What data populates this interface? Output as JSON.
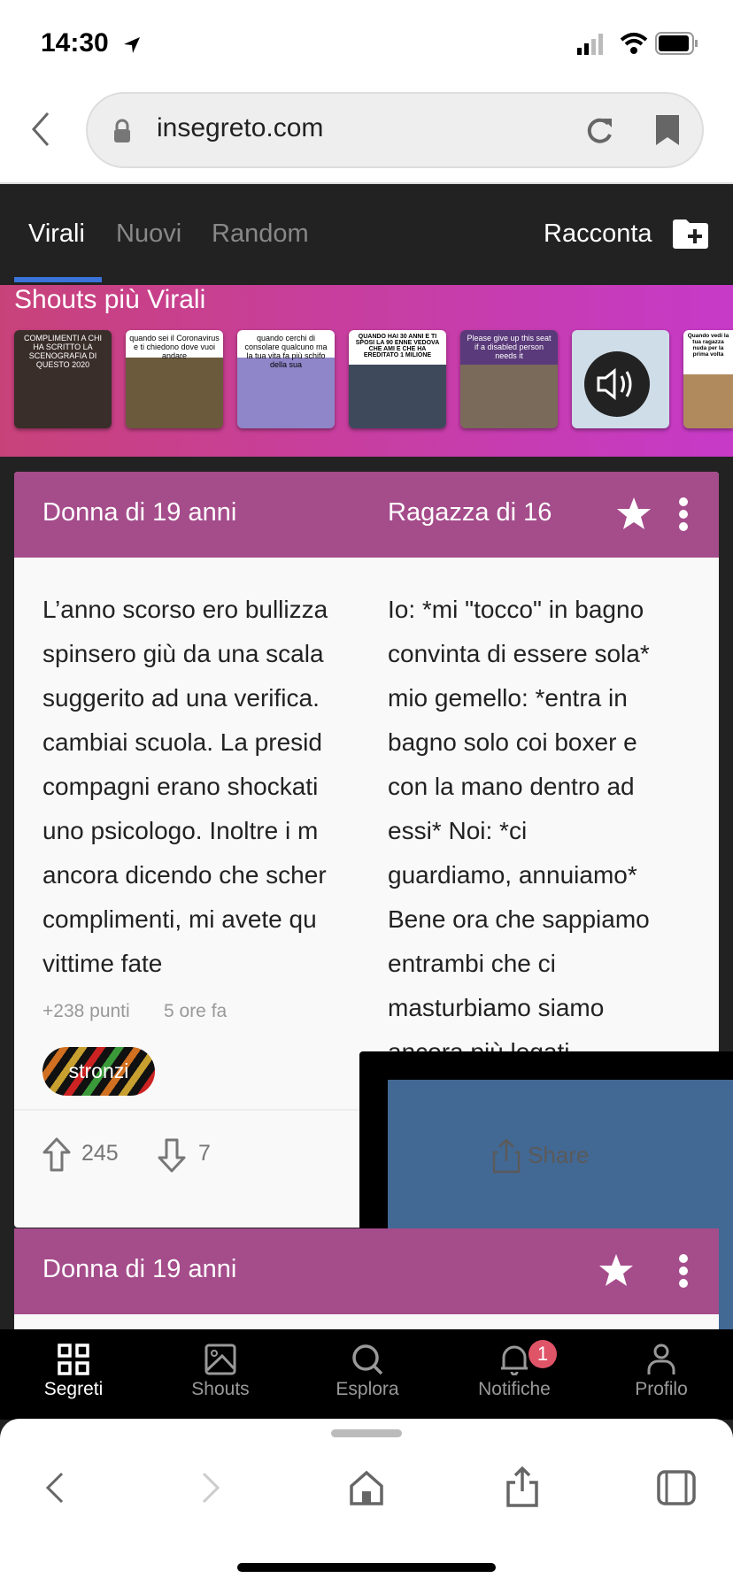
{
  "status_bar": {
    "time": "14:30"
  },
  "browser": {
    "url": "insegreto.com"
  },
  "header": {
    "tabs": [
      {
        "label": "Virali",
        "active": true
      },
      {
        "label": "Nuovi"
      },
      {
        "label": "Random"
      }
    ],
    "racconta_label": "Racconta"
  },
  "shouts": {
    "title": "Shouts più Virali",
    "thumbnails": [
      {
        "caption": "COMPLIMENTI A CHI HA SCRITTO LA SCENOGRAFIA DI QUESTO 2020",
        "bg": "#3a2e2a"
      },
      {
        "caption": "quando sei il Coronavirus e ti chiedono dove vuoi andare",
        "bg": "#6b5a3c"
      },
      {
        "caption": "quando cerchi di consolare qualcuno ma la tua vita fa più schifo della sua",
        "bg": "#8f86c9"
      },
      {
        "caption": "QUANDO HAI 30 ANNI E TI SPOSI LA 90 ENNE VEDOVA CHE AMI E CHE HA EREDITATO 1 MILIONE",
        "bg": "#3e4a5c"
      },
      {
        "caption": "Please give up this seat if a disabled person needs it",
        "bg": "#7a6a5a"
      },
      {
        "caption": "",
        "bg": "#cfdde8"
      },
      {
        "caption": "Quando vedi la tua ragazza nuda per la prima volta",
        "bg": "#b08a5c"
      }
    ]
  },
  "cards": [
    {
      "author": "Donna di 19 anni",
      "lines": [
        "L’anno scorso ero bullizza",
        "spinsero giù da una scala",
        "suggerito ad una verifica.",
        "cambiai scuola. La presid",
        "compagni erano shockati",
        "uno psicologo. Inoltre i m",
        "ancora dicendo che scher",
        "complimenti, mi avete qu",
        "vittime fate"
      ],
      "points": "+238 punti",
      "time": "5 ore fa",
      "tag": "stronzi",
      "upvotes": "245",
      "downvotes": "7"
    },
    {
      "author": "Ragazza di 16",
      "lines": [
        "Io: *mi \"tocco\" in bagno",
        "convinta di essere sola*",
        "mio gemello: *entra in",
        "bagno solo coi boxer e",
        "con la mano dentro ad",
        "essi* Noi: *ci",
        "guardiamo, annuiamo*",
        "Bene ora che sappiamo",
        "entrambi che ci",
        "masturbiamo siamo",
        "ancora più legati"
      ]
    },
    {
      "author": "Donna di 19 anni"
    }
  ],
  "share_label": "Share",
  "bottom_nav": [
    {
      "label": "Segreti",
      "active": true
    },
    {
      "label": "Shouts"
    },
    {
      "label": "Esplora"
    },
    {
      "label": "Notifiche",
      "badge": "1"
    },
    {
      "label": "Profilo"
    }
  ],
  "colors": {
    "card_header": "#a54c8b",
    "accent": "#3a73d9",
    "badge": "#e05468",
    "share_bg": "#426894"
  }
}
